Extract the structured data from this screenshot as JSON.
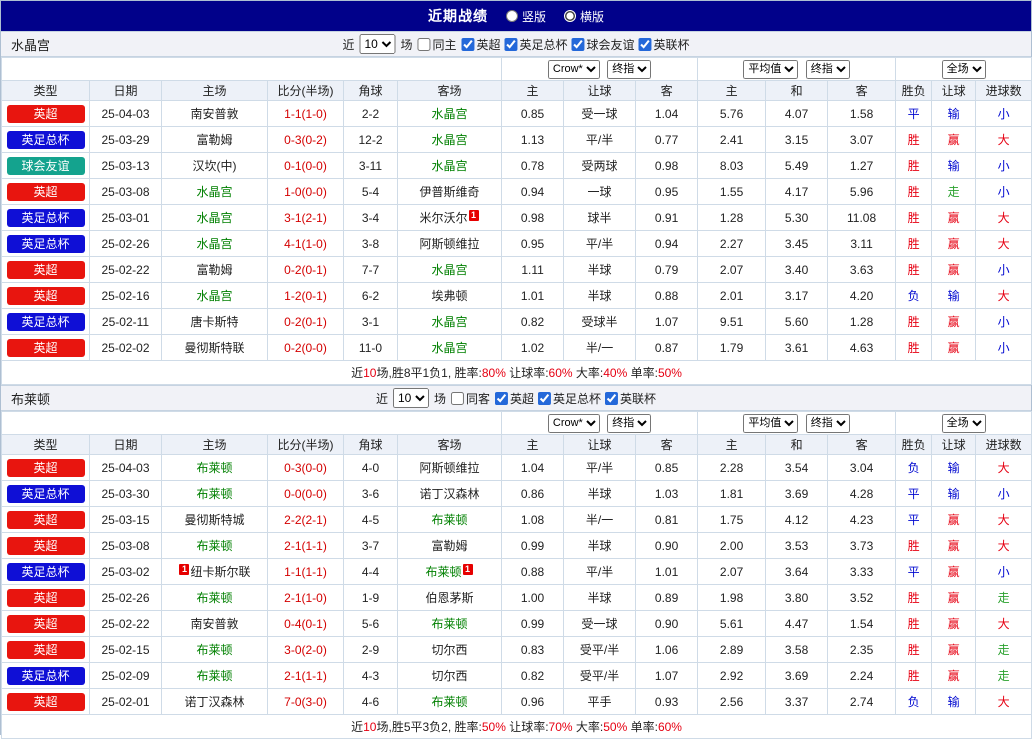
{
  "header": {
    "title": "近期战绩",
    "layout_options": [
      {
        "label": "竖版",
        "checked": false
      },
      {
        "label": "横版",
        "checked": true
      }
    ]
  },
  "labels": {
    "near": "近",
    "matches": "场"
  },
  "columns": {
    "type": "类型",
    "date": "日期",
    "home": "主场",
    "score": "比分(半场)",
    "corner": "角球",
    "away": "客场",
    "odds_home": "主",
    "odds_handicap": "让球",
    "odds_away": "客",
    "avg_home": "主",
    "avg_draw": "和",
    "avg_away": "客",
    "outcome": "胜负",
    "handicap_result": "让球",
    "goals": "进球数"
  },
  "selects": {
    "odds_source": "Crow*",
    "odds_time": "终指",
    "avg_source": "平均值",
    "avg_time": "终指",
    "scope": "全场"
  },
  "colors": {
    "league": {
      "英超": "#e8150f",
      "英足总杯": "#0f0fd6",
      "球会友谊": "#14a38e"
    },
    "result": {
      "胜": "#e60012",
      "平": "#0008d0",
      "负": "#0008d0",
      "赢": "#e60012",
      "输": "#0008d0",
      "走": "#2aa12e",
      "大": "#e60012",
      "小": "#0008d0"
    },
    "score": "#d40000",
    "team": "#008000",
    "emphasis": "#e60012"
  },
  "sections": [
    {
      "team": "水晶宫",
      "count": "10",
      "venue_filter": {
        "label": "同主",
        "checked": false
      },
      "filters": [
        {
          "label": "英超",
          "checked": true
        },
        {
          "label": "英足总杯",
          "checked": true
        },
        {
          "label": "球会友谊",
          "checked": true
        },
        {
          "label": "英联杯",
          "checked": true
        }
      ],
      "rows": [
        {
          "league": "英超",
          "date": "25-04-03",
          "home": "南安普敦",
          "score": "1-1(1-0)",
          "corner": "2-2",
          "away": "水晶宫",
          "away_green": true,
          "odds": [
            "0.85",
            "受一球",
            "1.04"
          ],
          "avg": [
            "5.76",
            "4.07",
            "1.58"
          ],
          "result": [
            "平",
            "输",
            "小"
          ]
        },
        {
          "league": "英足总杯",
          "date": "25-03-29",
          "home": "富勒姆",
          "score": "0-3(0-2)",
          "corner": "12-2",
          "away": "水晶宫",
          "away_green": true,
          "odds": [
            "1.13",
            "平/半",
            "0.77"
          ],
          "avg": [
            "2.41",
            "3.15",
            "3.07"
          ],
          "result": [
            "胜",
            "赢",
            "大"
          ]
        },
        {
          "league": "球会友谊",
          "date": "25-03-13",
          "home": "汉坎(中)",
          "score": "0-1(0-0)",
          "corner": "3-11",
          "away": "水晶宫",
          "away_green": true,
          "odds": [
            "0.78",
            "受两球",
            "0.98"
          ],
          "avg": [
            "8.03",
            "5.49",
            "1.27"
          ],
          "result": [
            "胜",
            "输",
            "小"
          ]
        },
        {
          "league": "英超",
          "date": "25-03-08",
          "home": "水晶宫",
          "home_green": true,
          "score": "1-0(0-0)",
          "corner": "5-4",
          "away": "伊普斯维奇",
          "odds": [
            "0.94",
            "一球",
            "0.95"
          ],
          "avg": [
            "1.55",
            "4.17",
            "5.96"
          ],
          "result": [
            "胜",
            "走",
            "小"
          ]
        },
        {
          "league": "英足总杯",
          "date": "25-03-01",
          "home": "水晶宫",
          "home_green": true,
          "score": "3-1(2-1)",
          "corner": "3-4",
          "away": "米尔沃尔",
          "away_card": "1",
          "odds": [
            "0.98",
            "球半",
            "0.91"
          ],
          "avg": [
            "1.28",
            "5.30",
            "11.08"
          ],
          "result": [
            "胜",
            "赢",
            "大"
          ]
        },
        {
          "league": "英足总杯",
          "date": "25-02-26",
          "home": "水晶宫",
          "home_green": true,
          "score": "4-1(1-0)",
          "corner": "3-8",
          "away": "阿斯顿维拉",
          "odds": [
            "0.95",
            "平/半",
            "0.94"
          ],
          "avg": [
            "2.27",
            "3.45",
            "3.11"
          ],
          "result": [
            "胜",
            "赢",
            "大"
          ]
        },
        {
          "league": "英超",
          "date": "25-02-22",
          "home": "富勒姆",
          "score": "0-2(0-1)",
          "corner": "7-7",
          "away": "水晶宫",
          "away_green": true,
          "odds": [
            "1.11",
            "半球",
            "0.79"
          ],
          "avg": [
            "2.07",
            "3.40",
            "3.63"
          ],
          "result": [
            "胜",
            "赢",
            "小"
          ]
        },
        {
          "league": "英超",
          "date": "25-02-16",
          "home": "水晶宫",
          "home_green": true,
          "score": "1-2(0-1)",
          "corner": "6-2",
          "away": "埃弗顿",
          "odds": [
            "1.01",
            "半球",
            "0.88"
          ],
          "avg": [
            "2.01",
            "3.17",
            "4.20"
          ],
          "result": [
            "负",
            "输",
            "大"
          ]
        },
        {
          "league": "英足总杯",
          "date": "25-02-11",
          "home": "唐卡斯特",
          "score": "0-2(0-1)",
          "corner": "3-1",
          "away": "水晶宫",
          "away_green": true,
          "odds": [
            "0.82",
            "受球半",
            "1.07"
          ],
          "avg": [
            "9.51",
            "5.60",
            "1.28"
          ],
          "result": [
            "胜",
            "赢",
            "小"
          ]
        },
        {
          "league": "英超",
          "date": "25-02-02",
          "home": "曼彻斯特联",
          "score": "0-2(0-0)",
          "corner": "11-0",
          "away": "水晶宫",
          "away_green": true,
          "odds": [
            "1.02",
            "半/一",
            "0.87"
          ],
          "avg": [
            "1.79",
            "3.61",
            "4.63"
          ],
          "result": [
            "胜",
            "赢",
            "小"
          ]
        }
      ],
      "summary": [
        {
          "text": "近",
          "red": false
        },
        {
          "text": "10",
          "red": true
        },
        {
          "text": "场,胜8平1负1, 胜率:",
          "red": false
        },
        {
          "text": "80%",
          "red": true
        },
        {
          "text": " 让球率:",
          "red": false
        },
        {
          "text": "60%",
          "red": true
        },
        {
          "text": " 大率:",
          "red": false
        },
        {
          "text": "40%",
          "red": true
        },
        {
          "text": " 单率:",
          "red": false
        },
        {
          "text": "50%",
          "red": true
        }
      ]
    },
    {
      "team": "布莱顿",
      "count": "10",
      "venue_filter": {
        "label": "同客",
        "checked": false
      },
      "filters": [
        {
          "label": "英超",
          "checked": true
        },
        {
          "label": "英足总杯",
          "checked": true
        },
        {
          "label": "英联杯",
          "checked": true
        }
      ],
      "rows": [
        {
          "league": "英超",
          "date": "25-04-03",
          "home": "布莱顿",
          "home_green": true,
          "score": "0-3(0-0)",
          "corner": "4-0",
          "away": "阿斯顿维拉",
          "odds": [
            "1.04",
            "平/半",
            "0.85"
          ],
          "avg": [
            "2.28",
            "3.54",
            "3.04"
          ],
          "result": [
            "负",
            "输",
            "大"
          ]
        },
        {
          "league": "英足总杯",
          "date": "25-03-30",
          "home": "布莱顿",
          "home_green": true,
          "score": "0-0(0-0)",
          "corner": "3-6",
          "away": "诺丁汉森林",
          "odds": [
            "0.86",
            "半球",
            "1.03"
          ],
          "avg": [
            "1.81",
            "3.69",
            "4.28"
          ],
          "result": [
            "平",
            "输",
            "小"
          ]
        },
        {
          "league": "英超",
          "date": "25-03-15",
          "home": "曼彻斯特城",
          "score": "2-2(2-1)",
          "corner": "4-5",
          "away": "布莱顿",
          "away_green": true,
          "odds": [
            "1.08",
            "半/一",
            "0.81"
          ],
          "avg": [
            "1.75",
            "4.12",
            "4.23"
          ],
          "result": [
            "平",
            "赢",
            "大"
          ]
        },
        {
          "league": "英超",
          "date": "25-03-08",
          "home": "布莱顿",
          "home_green": true,
          "score": "2-1(1-1)",
          "corner": "3-7",
          "away": "富勒姆",
          "odds": [
            "0.99",
            "半球",
            "0.90"
          ],
          "avg": [
            "2.00",
            "3.53",
            "3.73"
          ],
          "result": [
            "胜",
            "赢",
            "大"
          ]
        },
        {
          "league": "英足总杯",
          "date": "25-03-02",
          "home": "纽卡斯尔联",
          "home_card_pre": "1",
          "score": "1-1(1-1)",
          "corner": "4-4",
          "away": "布莱顿",
          "away_green": true,
          "away_card": "1",
          "odds": [
            "0.88",
            "平/半",
            "1.01"
          ],
          "avg": [
            "2.07",
            "3.64",
            "3.33"
          ],
          "result": [
            "平",
            "赢",
            "小"
          ]
        },
        {
          "league": "英超",
          "date": "25-02-26",
          "home": "布莱顿",
          "home_green": true,
          "score": "2-1(1-0)",
          "corner": "1-9",
          "away": "伯恩茅斯",
          "odds": [
            "1.00",
            "半球",
            "0.89"
          ],
          "avg": [
            "1.98",
            "3.80",
            "3.52"
          ],
          "result": [
            "胜",
            "赢",
            "走"
          ]
        },
        {
          "league": "英超",
          "date": "25-02-22",
          "home": "南安普敦",
          "score": "0-4(0-1)",
          "corner": "5-6",
          "away": "布莱顿",
          "away_green": true,
          "odds": [
            "0.99",
            "受一球",
            "0.90"
          ],
          "avg": [
            "5.61",
            "4.47",
            "1.54"
          ],
          "result": [
            "胜",
            "赢",
            "大"
          ]
        },
        {
          "league": "英超",
          "date": "25-02-15",
          "home": "布莱顿",
          "home_green": true,
          "score": "3-0(2-0)",
          "corner": "2-9",
          "away": "切尔西",
          "odds": [
            "0.83",
            "受平/半",
            "1.06"
          ],
          "avg": [
            "2.89",
            "3.58",
            "2.35"
          ],
          "result": [
            "胜",
            "赢",
            "走"
          ]
        },
        {
          "league": "英足总杯",
          "date": "25-02-09",
          "home": "布莱顿",
          "home_green": true,
          "score": "2-1(1-1)",
          "corner": "4-3",
          "away": "切尔西",
          "odds": [
            "0.82",
            "受平/半",
            "1.07"
          ],
          "avg": [
            "2.92",
            "3.69",
            "2.24"
          ],
          "result": [
            "胜",
            "赢",
            "走"
          ]
        },
        {
          "league": "英超",
          "date": "25-02-01",
          "home": "诺丁汉森林",
          "score": "7-0(3-0)",
          "corner": "4-6",
          "away": "布莱顿",
          "away_green": true,
          "odds": [
            "0.96",
            "平手",
            "0.93"
          ],
          "avg": [
            "2.56",
            "3.37",
            "2.74"
          ],
          "result": [
            "负",
            "输",
            "大"
          ]
        }
      ],
      "summary": [
        {
          "text": "近",
          "red": false
        },
        {
          "text": "10",
          "red": true
        },
        {
          "text": "场,胜5平3负2, 胜率:",
          "red": false
        },
        {
          "text": "50%",
          "red": true
        },
        {
          "text": " 让球率:",
          "red": false
        },
        {
          "text": "70%",
          "red": true
        },
        {
          "text": " 大率:",
          "red": false
        },
        {
          "text": "50%",
          "red": true
        },
        {
          "text": " 单率:",
          "red": false
        },
        {
          "text": "60%",
          "red": true
        }
      ]
    }
  ]
}
